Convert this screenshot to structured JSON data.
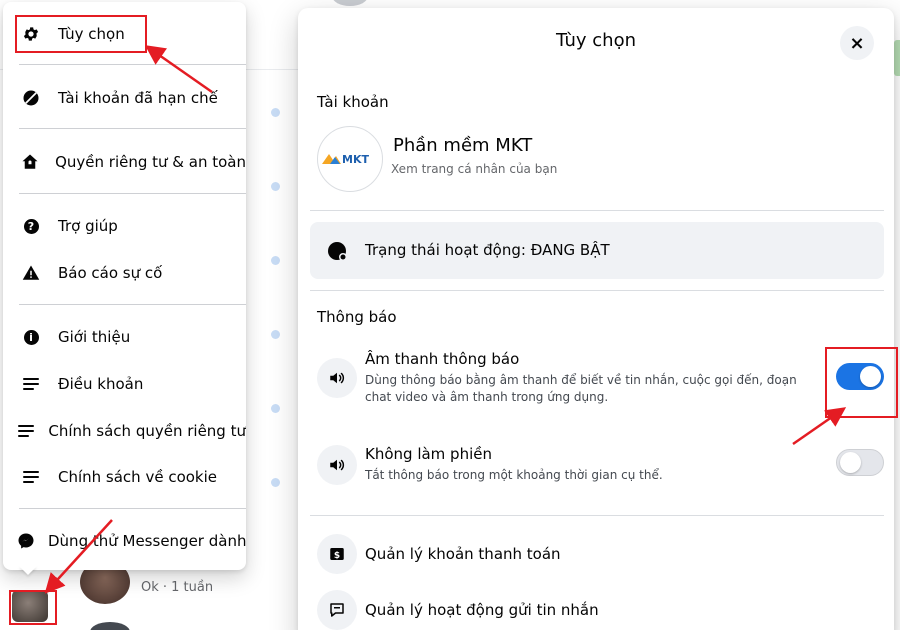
{
  "menu": {
    "items": [
      {
        "label": "Tùy chọn",
        "icon": "gear-icon"
      },
      {
        "label": "Tài khoản đã hạn chế",
        "icon": "restricted-icon"
      },
      {
        "label": "Quyền riêng tư & an toàn",
        "icon": "home-shield-icon"
      },
      {
        "label": "Trợ giúp",
        "icon": "help-icon"
      },
      {
        "label": "Báo cáo sự cố",
        "icon": "warning-icon"
      },
      {
        "label": "Giới thiệu",
        "icon": "info-icon"
      },
      {
        "label": "Điều khoản",
        "icon": "document-icon"
      },
      {
        "label": "Chính sách quyền riêng tư",
        "icon": "document-icon"
      },
      {
        "label": "Chính sách về cookie",
        "icon": "document-icon"
      },
      {
        "label": "Dùng thử Messenger dành",
        "icon": "messenger-icon"
      }
    ]
  },
  "conversation": {
    "preview": "Ok · 1 tuần"
  },
  "dialog": {
    "title": "Tùy chọn",
    "close_label": "×",
    "account_section": "Tài khoản",
    "profile": {
      "logo_text": "MKT",
      "name": "Phần mềm MKT",
      "subtitle": "Xem trang cá nhân của bạn"
    },
    "active_status": "Trạng thái hoạt động: ĐANG BẬT",
    "notifications_section": "Thông báo",
    "notification_sound": {
      "title": "Âm thanh thông báo",
      "description": "Dùng thông báo bằng âm thanh để biết về tin nhắn, cuộc gọi đến, đoạn chat video và âm thanh trong ứng dụng.",
      "enabled": true
    },
    "do_not_disturb": {
      "title": "Không làm phiền",
      "description": "Tắt thông báo trong một khoảng thời gian cụ thể.",
      "enabled": false
    },
    "manage_payments": "Quản lý khoản thanh toán",
    "manage_message_delivery": "Quản lý hoạt động gửi tin nhắn"
  },
  "colors": {
    "accent": "#1b74e4",
    "annotation": "#e41c23",
    "text": "#050505",
    "secondary_text": "#65676b"
  }
}
